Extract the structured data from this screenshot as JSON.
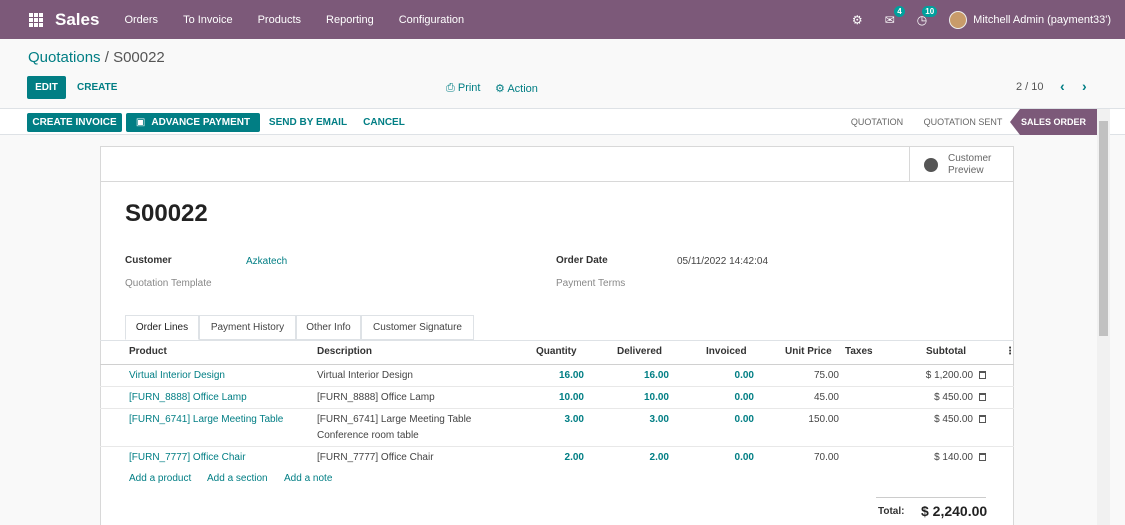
{
  "navbar": {
    "brand": "Sales",
    "menu": [
      "Orders",
      "To Invoice",
      "Products",
      "Reporting",
      "Configuration"
    ],
    "messages_count": "4",
    "activities_count": "10",
    "user": "Mitchell Admin (payment33')"
  },
  "breadcrumb": {
    "parent": "Quotations",
    "separator": " / ",
    "current": "S00022"
  },
  "control": {
    "edit": "EDIT",
    "create": "CREATE",
    "print": "Print",
    "action": "Action",
    "pager": "2 / 10"
  },
  "statusbar": {
    "buttons": [
      "CREATE INVOICE",
      "ADVANCE PAYMENT",
      "SEND BY EMAIL",
      "CANCEL"
    ],
    "stages": [
      "QUOTATION",
      "QUOTATION SENT",
      "SALES ORDER"
    ],
    "active_stage": "SALES ORDER"
  },
  "sheet": {
    "preview_line1": "Customer",
    "preview_line2": "Preview",
    "name": "S00022",
    "customer_label": "Customer",
    "customer": "Azkatech",
    "template_label": "Quotation Template",
    "order_date_label": "Order Date",
    "order_date": "05/11/2022 14:42:04",
    "payment_terms_label": "Payment Terms"
  },
  "tabs": [
    "Order Lines",
    "Payment History",
    "Other Info",
    "Customer Signature"
  ],
  "table": {
    "headers": [
      "Product",
      "Description",
      "Quantity",
      "Delivered",
      "Invoiced",
      "Unit Price",
      "Taxes",
      "Subtotal"
    ],
    "rows": [
      {
        "product": "Virtual Interior Design",
        "description": "Virtual Interior Design",
        "description2": "",
        "quantity": "16.00",
        "delivered": "16.00",
        "invoiced": "0.00",
        "unit_price": "75.00",
        "subtotal": "$ 1,200.00"
      },
      {
        "product": "[FURN_8888] Office Lamp",
        "description": "[FURN_8888] Office Lamp",
        "description2": "",
        "quantity": "10.00",
        "delivered": "10.00",
        "invoiced": "0.00",
        "unit_price": "45.00",
        "subtotal": "$ 450.00"
      },
      {
        "product": "[FURN_6741] Large Meeting Table",
        "description": "[FURN_6741] Large Meeting Table",
        "description2": "Conference room table",
        "quantity": "3.00",
        "delivered": "3.00",
        "invoiced": "0.00",
        "unit_price": "150.00",
        "subtotal": "$ 450.00"
      },
      {
        "product": "[FURN_7777] Office Chair",
        "description": "[FURN_7777] Office Chair",
        "description2": "",
        "quantity": "2.00",
        "delivered": "2.00",
        "invoiced": "0.00",
        "unit_price": "70.00",
        "subtotal": "$ 140.00"
      }
    ],
    "add_links": [
      "Add a product",
      "Add a section",
      "Add a note"
    ]
  },
  "totals": {
    "label": "Total:",
    "value": "$ 2,240.00"
  }
}
